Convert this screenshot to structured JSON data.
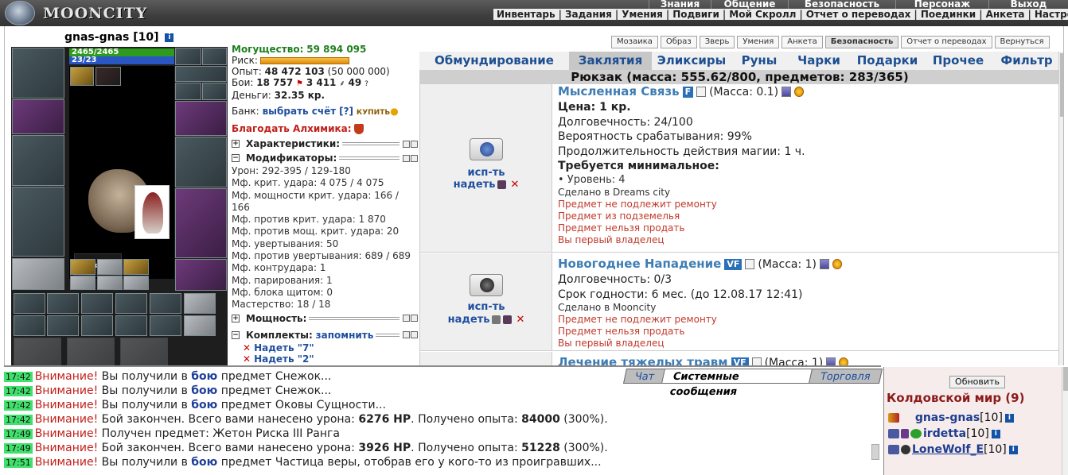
{
  "app": {
    "logo_text": "MOONCITY"
  },
  "top_menu": [
    "Знания",
    "Общение",
    "Безопасность",
    "Персонаж",
    "Выход"
  ],
  "sub_menu": [
    "Инвентарь",
    "Задания",
    "Умения",
    "Подвиги",
    "Мой Скролл",
    "Отчет о переводах",
    "Поединки",
    "Анкета",
    "Настройки"
  ],
  "character": {
    "name": "gnas-gnas",
    "level": "[10]",
    "hp": "2465/2465",
    "mp": "23/23"
  },
  "stats": {
    "power_label": "Могущество:",
    "power_value": "59 894 095",
    "risk_label": "Риск:",
    "exp_label": "Опыт:",
    "exp_value": "48 472 103",
    "exp_next": "(50 000 000)",
    "battles_label": "Бои:",
    "battles_won": "18 757",
    "battles_lost": "3 411",
    "battles_draw": "49",
    "money_label": "Деньги:",
    "money_value": "32.35 кр.",
    "bank_label": "Банк:",
    "bank_link": "выбрать счёт",
    "bank_help": "[?]",
    "bank_buy": "КУПИТЬ",
    "alchemist": "Благодать Алхимика:"
  },
  "sections": {
    "characteristics": "Характеристики:",
    "modifiers": "Модификаторы:",
    "power": "Мощность:",
    "kits": "Комплекты:",
    "kits_save": "запомнить"
  },
  "modifiers": [
    "Урон: 292-395 / 129-180",
    "Мф. крит. удара: 4 075 / 4 075",
    "Мф. мощности крит. удара: 166 /",
    "166",
    "Мф. против крит. удара: 1 870",
    "Мф. против мощ. крит. удара: 20",
    "Мф. увертывания: 50",
    "Мф. против увертывания: 689 / 689",
    "Мф. контрудара: 1",
    "Мф. парирования: 1",
    "Мф. блока щитом: 0",
    "Мастерство: 18 / 18"
  ],
  "kits": [
    "Надеть \"7\"",
    "Надеть \"2\""
  ],
  "sub_tabs": [
    {
      "label": "Мозаика",
      "active": false
    },
    {
      "label": "Образ",
      "active": false
    },
    {
      "label": "Зверь",
      "active": false
    },
    {
      "label": "Умения",
      "active": false
    },
    {
      "label": "Анкета",
      "active": false
    },
    {
      "label": "Безопасность",
      "active": true
    },
    {
      "label": "Отчет о переводах",
      "active": false
    },
    {
      "label": "Вернуться",
      "active": false
    }
  ],
  "category_tabs": [
    {
      "label": "Обмундирование",
      "active": false
    },
    {
      "label": "Заклятия",
      "active": true
    },
    {
      "label": "Эликсиры",
      "active": false
    },
    {
      "label": "Руны",
      "active": false
    },
    {
      "label": "Чарки",
      "active": false
    },
    {
      "label": "Подарки",
      "active": false
    },
    {
      "label": "Прочее",
      "active": false
    },
    {
      "label": "Фильтр",
      "active": false
    }
  ],
  "bag_header": "Рюкзак (масса: 555.62/800, предметов: 283/365)",
  "items": [
    {
      "title": "Мысленная Связь",
      "badge": "F",
      "mass": "(Масса: 0.1)",
      "use_label": "исп-ть",
      "wear_label": "надеть",
      "price": "Цена: 1 кр.",
      "durability": "Долговечность: 24/100",
      "trigger": "Вероятность срабатывания: 99%",
      "magic_duration": "Продолжительность действия магии: 1 ч.",
      "req_title": "Требуется минимальное:",
      "req_level": "• Уровень: 4",
      "made_in": "Сделано в Dreams city",
      "notes": [
        "Предмет не подлежит ремонту",
        "Предмет из подземелья",
        "Предмет нельзя продать",
        "Вы первый владелец"
      ]
    },
    {
      "title": "Новогоднее Нападение",
      "badge": "VF",
      "mass": "(Масса: 1)",
      "use_label": "исп-ть",
      "wear_label": "надеть",
      "durability": "Долговечность: 0/3",
      "expiry": "Срок годности: 6 мес. (до 12.08.17 12:41)",
      "made_in": "Сделано в Mooncity",
      "notes": [
        "Предмет не подлежит ремонту",
        "Предмет нельзя продать",
        "Вы первый владелец"
      ]
    },
    {
      "title": "Лечение тяжелых травм",
      "badge": "VF",
      "mass": "(Масса: 1)"
    }
  ],
  "chat": {
    "tabs": [
      {
        "label": "Чат",
        "active": false
      },
      {
        "label": "Системные сообщения",
        "active": true
      },
      {
        "label": "Торговля",
        "active": false
      }
    ],
    "messages": [
      {
        "time": "17:42",
        "warn": "Внимание!",
        "pre": " Вы получили в ",
        "bold": "бою",
        "post": " предмет Снежок..."
      },
      {
        "time": "17:42",
        "warn": "Внимание!",
        "pre": " Вы получили в ",
        "bold": "бою",
        "post": " предмет Снежок..."
      },
      {
        "time": "17:42",
        "warn": "Внимание!",
        "pre": " Вы получили в ",
        "bold": "бою",
        "post": " предмет Оковы Сущности..."
      },
      {
        "time": "17:42",
        "warn": "Внимание!",
        "pre": " Бой закончен. Всего вами нанесено урона: ",
        "bold": "6276 HP",
        "post": ". Получено опыта: ",
        "bold2": "84000",
        "post2": " (300%)."
      },
      {
        "time": "17:49",
        "warn": "Внимание!",
        "pre": " Получен предмет: Жетон Риска III Ранга",
        "bold": "",
        "post": ""
      },
      {
        "time": "17:49",
        "warn": "Внимание!",
        "pre": " Бой закончен. Всего вами нанесено урона: ",
        "bold": "3926 HP",
        "post": ". Получено опыта: ",
        "bold2": "51228",
        "post2": " (300%)."
      },
      {
        "time": "17:51",
        "warn": "Внимание!",
        "pre": " Вы получили в ",
        "bold": "бою",
        "post": " предмет Частица веры, отобрав его у кого-то из проигравших..."
      }
    ]
  },
  "online": {
    "refresh": "Обновить",
    "room": "Колдовской мир (9)",
    "users": [
      {
        "nick": "gnas-gnas",
        "level": "[10]"
      },
      {
        "nick": "irdetta",
        "level": "[10]"
      },
      {
        "nick": "LoneWolf_E",
        "level": "[10]"
      }
    ]
  },
  "colors": {
    "accent_blue": "#1f4fa0",
    "warning_red": "#c0201a",
    "time_green": "#41e06c"
  }
}
